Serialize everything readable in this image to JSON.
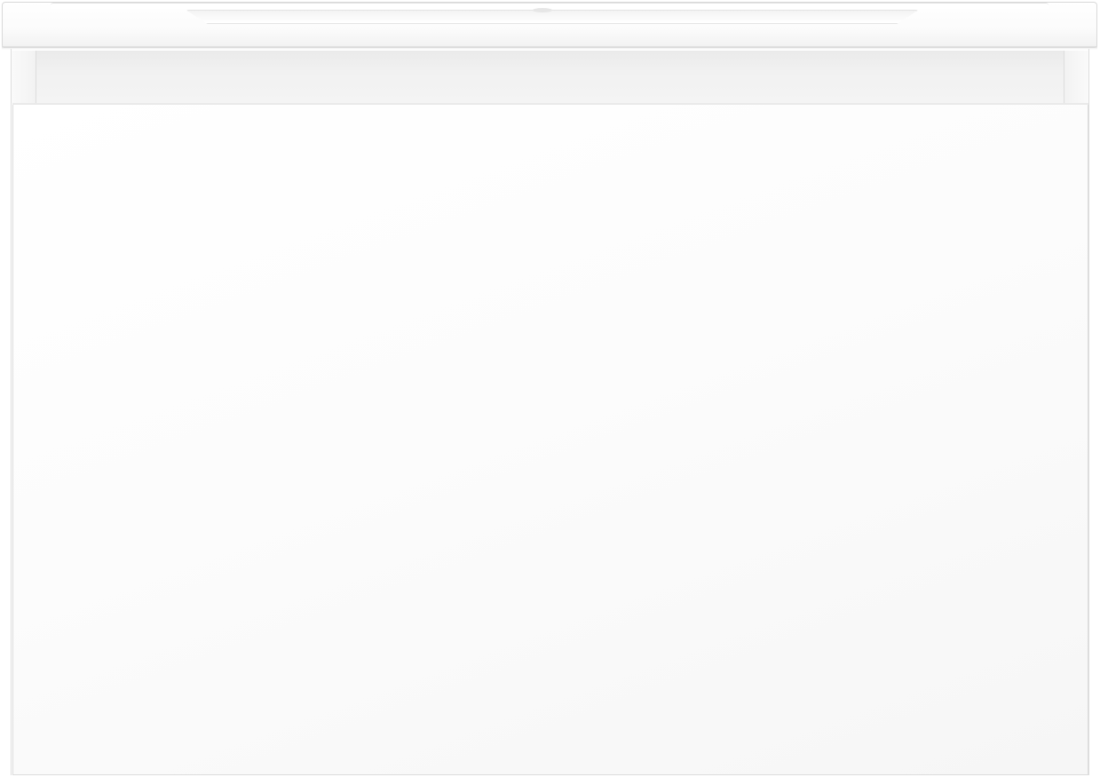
{
  "scene": {
    "subject": "",
    "colors": {
      "background": "#ffffff",
      "surface": "#ffffff",
      "edge": "#dcdcdc",
      "recess": "#eeeeee"
    }
  }
}
